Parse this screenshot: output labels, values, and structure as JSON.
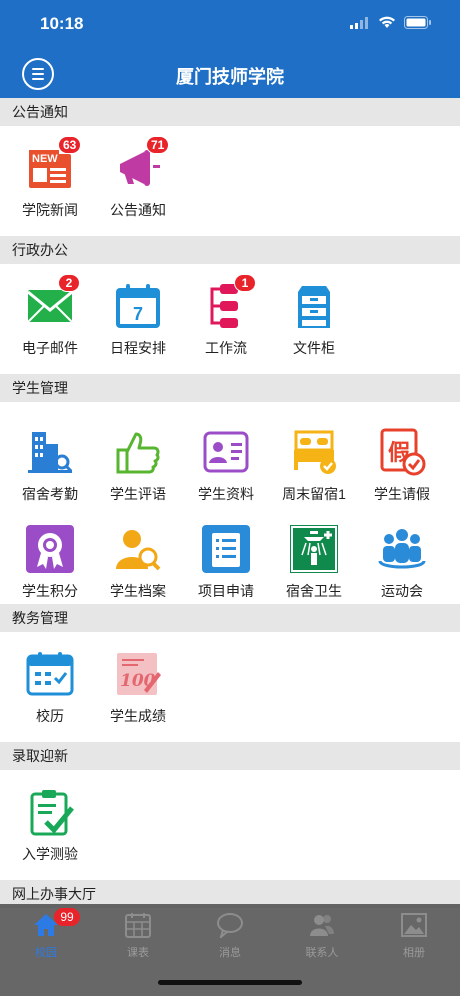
{
  "status_bar": {
    "time": "10:18"
  },
  "header": {
    "title": "厦门技师学院"
  },
  "sections": {
    "announcements": {
      "title": "公告通知",
      "items": [
        {
          "label": "学院新闻",
          "badge": "63",
          "icon": "news-icon"
        },
        {
          "label": "公告通知",
          "badge": "71",
          "icon": "megaphone-icon"
        }
      ]
    },
    "office": {
      "title": "行政办公",
      "items": [
        {
          "label": "电子邮件",
          "badge": "2",
          "icon": "mail-icon"
        },
        {
          "label": "日程安排",
          "icon": "calendar-icon",
          "calendar_day": "7"
        },
        {
          "label": "工作流",
          "badge": "1",
          "icon": "workflow-icon"
        },
        {
          "label": "文件柜",
          "icon": "cabinet-icon"
        }
      ]
    },
    "student": {
      "title": "学生管理",
      "items": [
        {
          "label": "宿舍考勤",
          "icon": "dorm-attendance-icon"
        },
        {
          "label": "学生评语",
          "icon": "thumbs-up-icon"
        },
        {
          "label": "学生资料",
          "icon": "profile-card-icon"
        },
        {
          "label": "周末留宿1",
          "icon": "bed-icon"
        },
        {
          "label": "学生请假",
          "icon": "leave-icon",
          "glyph": "假"
        },
        {
          "label": "学生积分",
          "icon": "medal-icon"
        },
        {
          "label": "学生档案",
          "icon": "user-search-icon"
        },
        {
          "label": "项目申请",
          "icon": "checklist-icon"
        },
        {
          "label": "宿舍卫生",
          "icon": "shower-icon"
        },
        {
          "label": "运动会",
          "icon": "group-icon"
        }
      ]
    },
    "academic": {
      "title": "教务管理",
      "items": [
        {
          "label": "校历",
          "icon": "school-calendar-icon"
        },
        {
          "label": "学生成绩",
          "icon": "grade-icon",
          "glyph": "100"
        }
      ]
    },
    "admission": {
      "title": "录取迎新",
      "items": [
        {
          "label": "入学测验",
          "icon": "clipboard-check-icon"
        }
      ]
    },
    "online_hall": {
      "title": "网上办事大厅"
    }
  },
  "tabbar": {
    "items": [
      {
        "label": "校园",
        "badge": "99",
        "icon": "home-icon",
        "active": true
      },
      {
        "label": "课表",
        "icon": "timetable-icon"
      },
      {
        "label": "消息",
        "icon": "chat-icon"
      },
      {
        "label": "联系人",
        "icon": "contacts-icon"
      },
      {
        "label": "相册",
        "icon": "album-icon"
      }
    ]
  },
  "colors": {
    "header_bg": "#1e6fc5",
    "section_bg": "#e6e6e6",
    "badge": "#e8242a",
    "tab_active": "#2c7be5"
  }
}
